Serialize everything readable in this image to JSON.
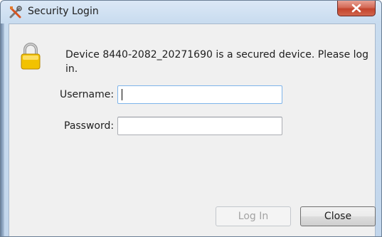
{
  "window": {
    "title": "Security Login"
  },
  "dialog": {
    "message": "Device 8440-2082_20271690 is a secured device. Please log in.",
    "username_label": "Username:",
    "username_value": "",
    "password_label": "Password:",
    "password_value": ""
  },
  "buttons": {
    "login_label": "Log In",
    "login_enabled": false,
    "close_label": "Close"
  },
  "icons": {
    "title": "tools-icon",
    "message": "padlock-icon",
    "window_close": "close-icon"
  },
  "colors": {
    "close_button_red": "#c3442d",
    "lock_gold": "#f2c200"
  }
}
